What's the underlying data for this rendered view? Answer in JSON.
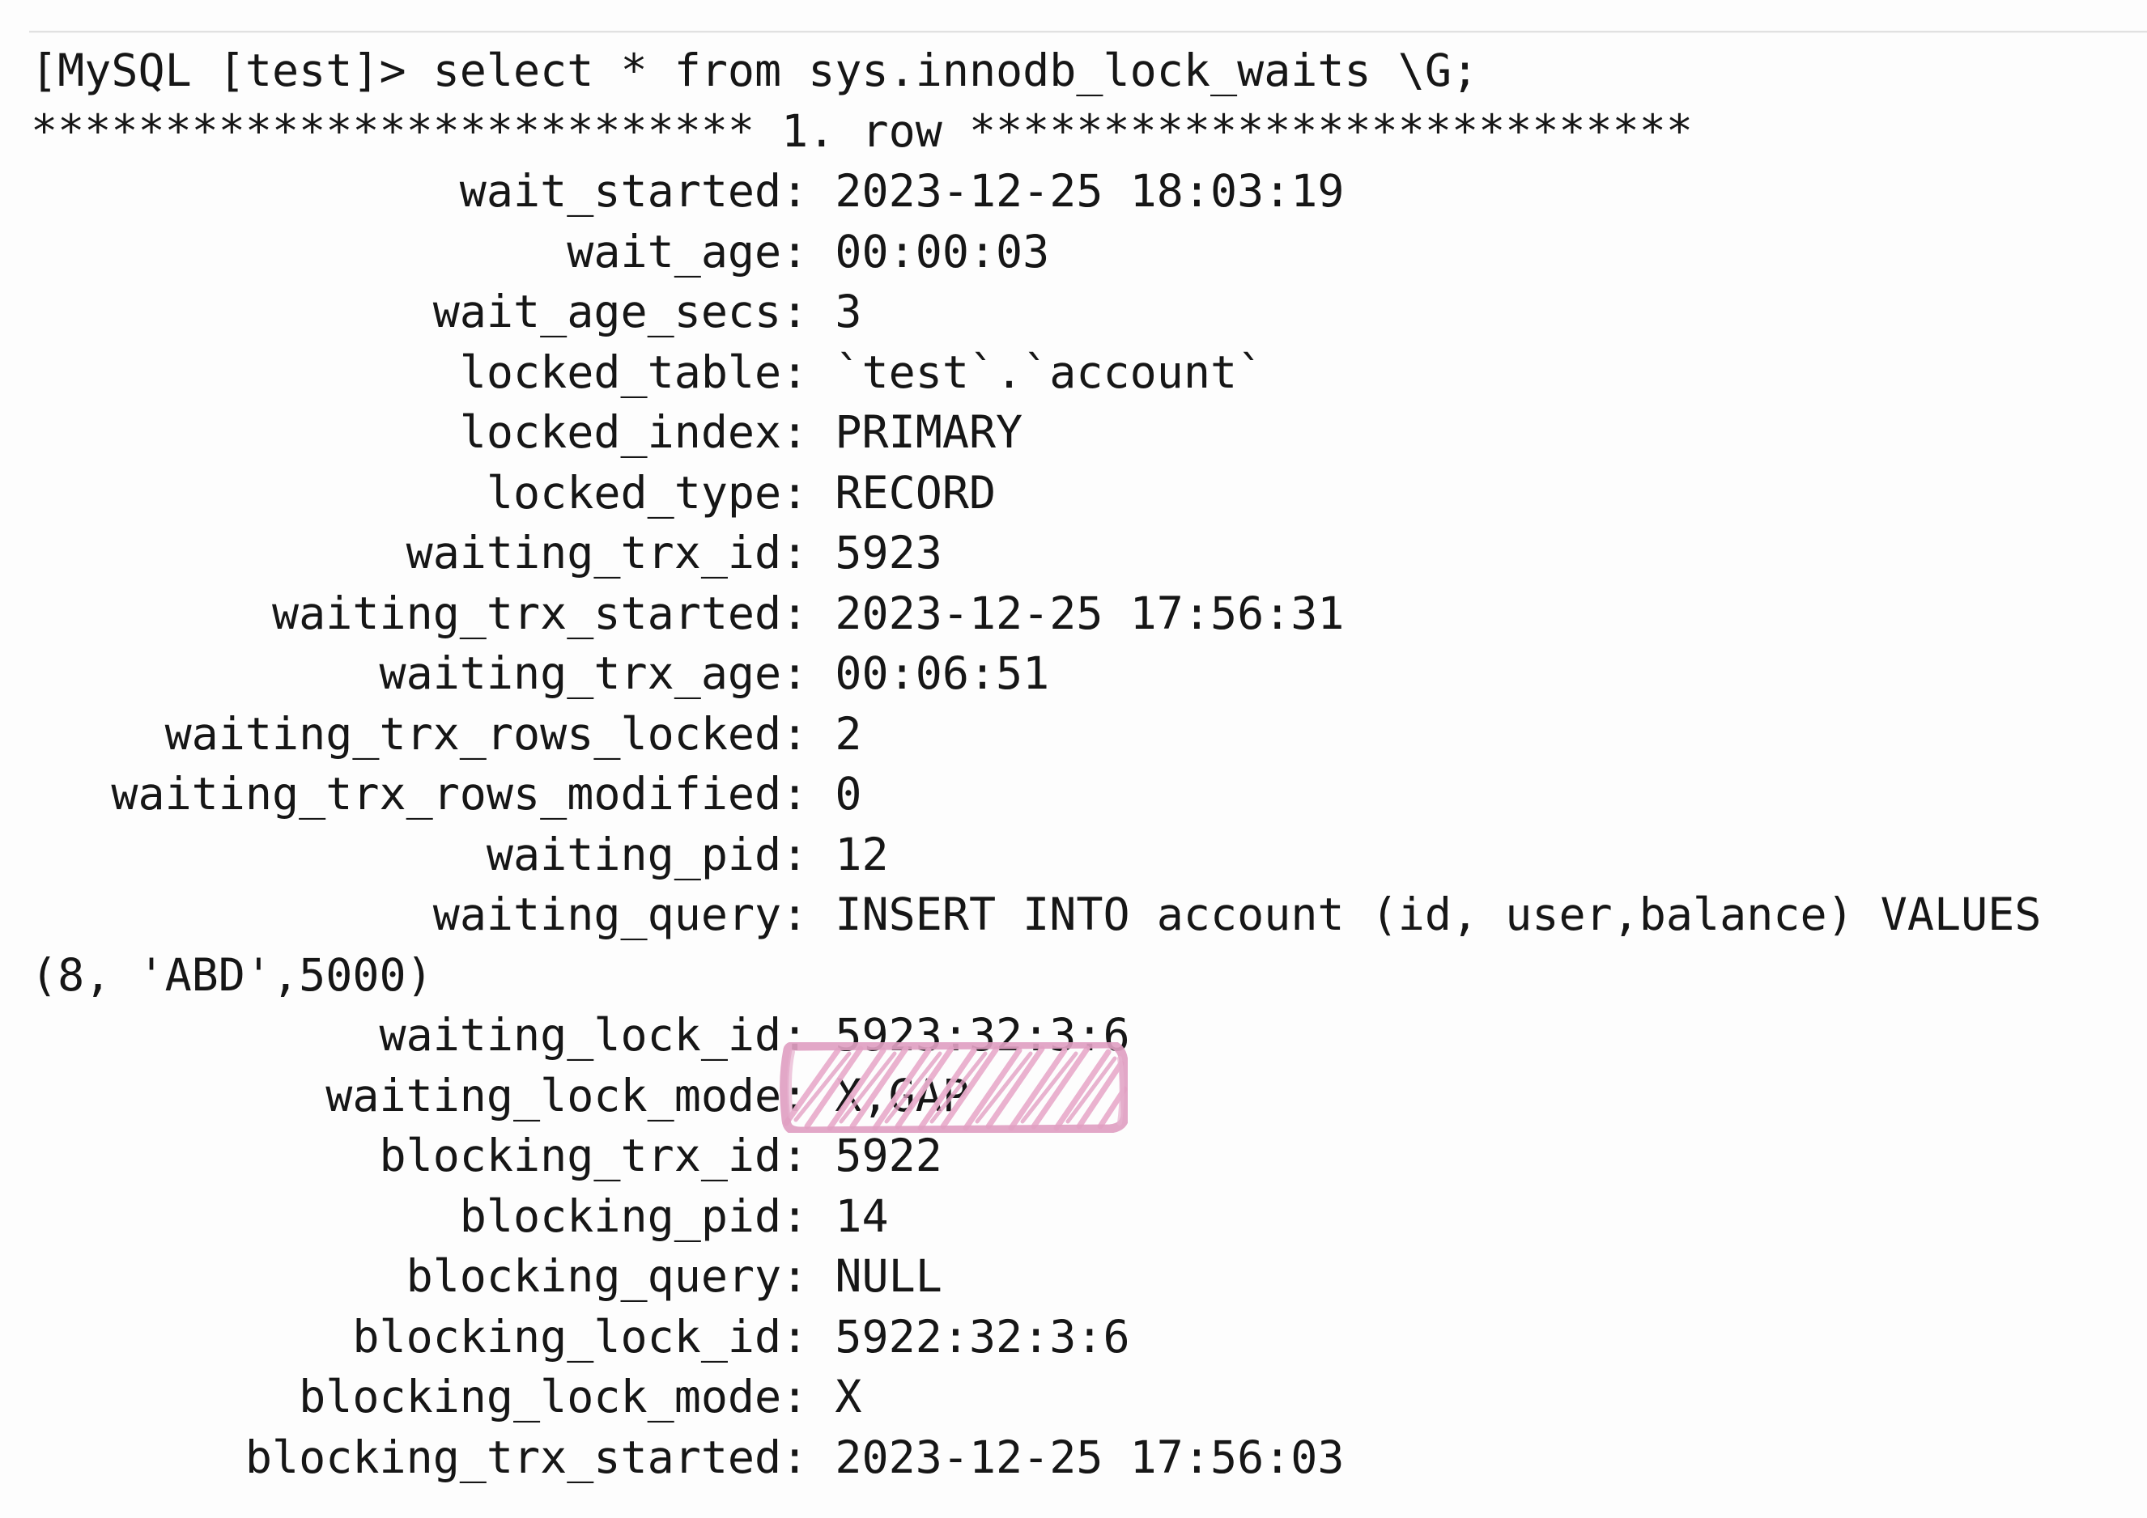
{
  "terminal": {
    "prompt_line": "[MySQL [test]> select * from sys.innodb_lock_waits \\G;",
    "row_separator": "*************************** 1. row ***************************",
    "fields": [
      {
        "label": "wait_started",
        "value": "2023-12-25 18:03:19"
      },
      {
        "label": "wait_age",
        "value": "00:00:03"
      },
      {
        "label": "wait_age_secs",
        "value": "3"
      },
      {
        "label": "locked_table",
        "value": "`test`.`account`"
      },
      {
        "label": "locked_index",
        "value": "PRIMARY"
      },
      {
        "label": "locked_type",
        "value": "RECORD"
      },
      {
        "label": "waiting_trx_id",
        "value": "5923"
      },
      {
        "label": "waiting_trx_started",
        "value": "2023-12-25 17:56:31"
      },
      {
        "label": "waiting_trx_age",
        "value": "00:06:51"
      },
      {
        "label": "waiting_trx_rows_locked",
        "value": "2"
      },
      {
        "label": "waiting_trx_rows_modified",
        "value": "0"
      },
      {
        "label": "waiting_pid",
        "value": "12"
      },
      {
        "label": "waiting_query",
        "value": "INSERT INTO account (id, user,balance) VALUES (8, 'ABD',5000)"
      },
      {
        "label": "waiting_lock_id",
        "value": "5923:32:3:6"
      },
      {
        "label": "waiting_lock_mode",
        "value": "X,GAP"
      },
      {
        "label": "blocking_trx_id",
        "value": "5922"
      },
      {
        "label": "blocking_pid",
        "value": "14"
      },
      {
        "label": "blocking_query",
        "value": "NULL"
      },
      {
        "label": "blocking_lock_id",
        "value": "5922:32:3:6"
      },
      {
        "label": "blocking_lock_mode",
        "value": "X"
      },
      {
        "label": "blocking_trx_started",
        "value": "2023-12-25 17:56:03"
      }
    ],
    "rendered_lines": [
      "[MySQL [test]> select * from sys.innodb_lock_waits \\G;",
      "*************************** 1. row ***************************",
      "                wait_started: 2023-12-25 18:03:19",
      "                    wait_age: 00:00:03",
      "               wait_age_secs: 3",
      "                locked_table: `test`.`account`",
      "                locked_index: PRIMARY",
      "                 locked_type: RECORD",
      "              waiting_trx_id: 5923",
      "         waiting_trx_started: 2023-12-25 17:56:31",
      "             waiting_trx_age: 00:06:51",
      "     waiting_trx_rows_locked: 2",
      "   waiting_trx_rows_modified: 0",
      "                 waiting_pid: 12",
      "               waiting_query: INSERT INTO account (id, user,balance) VALUES (8, 'ABD',5000)",
      "             waiting_lock_id: 5923:32:3:6",
      "           waiting_lock_mode: X,GAP",
      "             blocking_trx_id: 5922",
      "                blocking_pid: 14",
      "              blocking_query: NULL",
      "            blocking_lock_id: 5922:32:3:6",
      "          blocking_lock_mode: X",
      "        blocking_trx_started: 2023-12-25 17:56:03"
    ]
  },
  "annotation": {
    "type": "hand-drawn-highlight",
    "target_text": "X,GAP",
    "target_field": "waiting_lock_mode",
    "color": "#e3a1c4",
    "fill_color": "#eab4d0"
  },
  "colors": {
    "background": "#fdfdfd",
    "text": "#161616",
    "rule": "#d9d9d9",
    "highlight_pink": "#e3a1c4"
  }
}
